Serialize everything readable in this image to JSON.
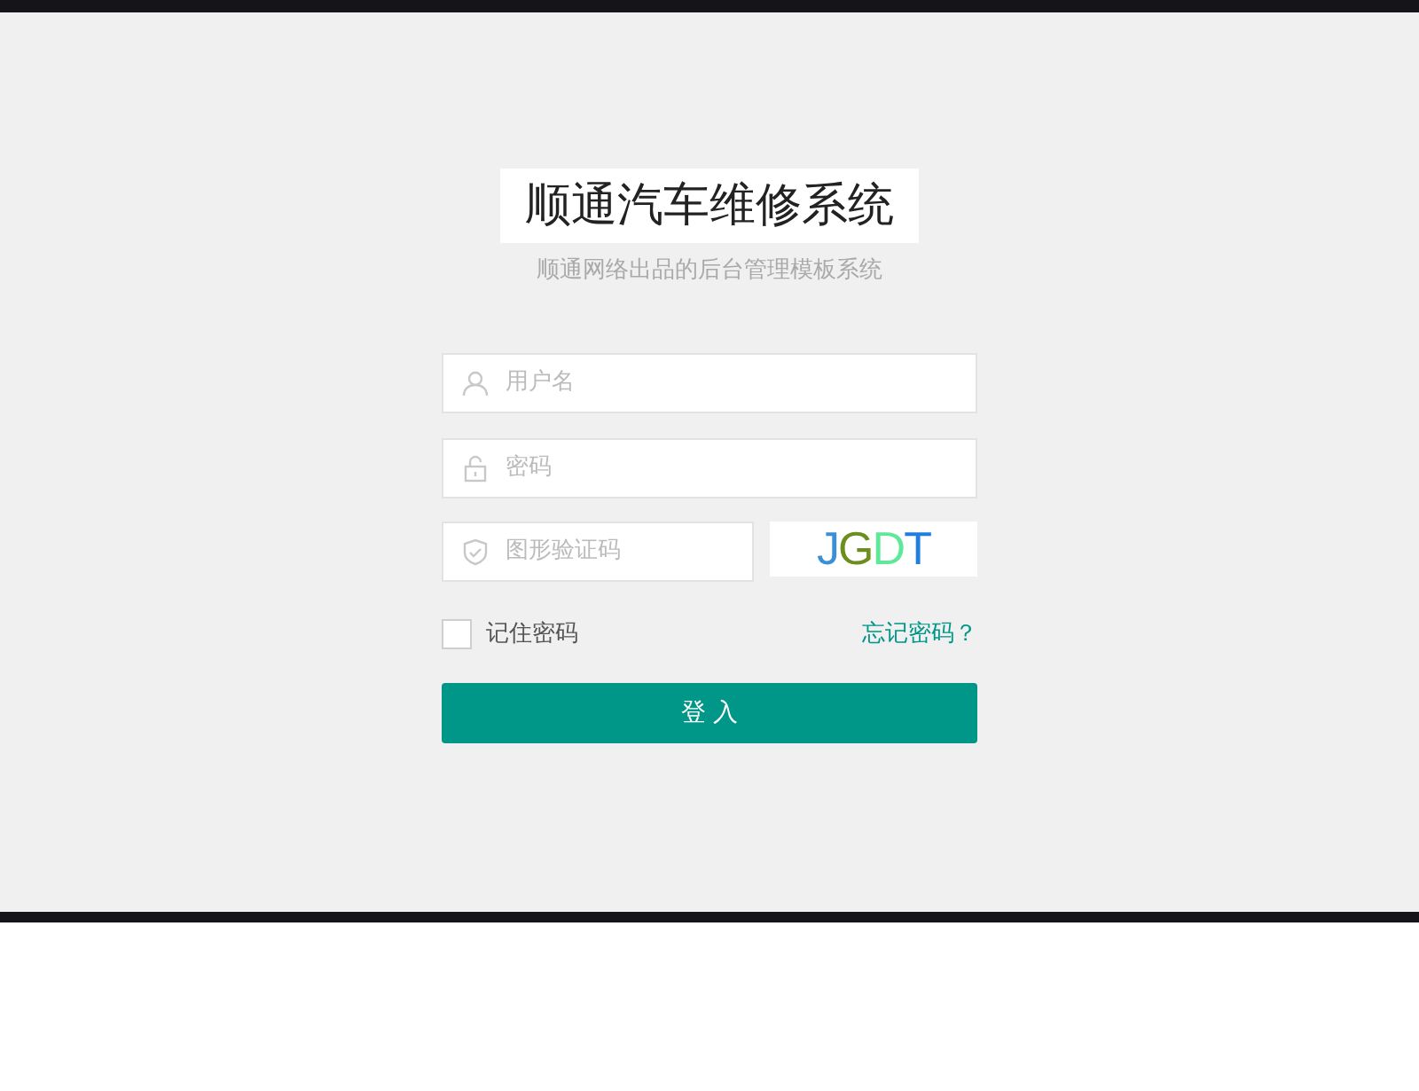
{
  "title": "顺通汽车维修系统",
  "subtitle": "顺通网络出品的后台管理模板系统",
  "fields": [
    {
      "kind": "user",
      "placeholder": "用户名"
    },
    {
      "kind": "lock",
      "placeholder": "密码"
    },
    {
      "kind": "shield",
      "placeholder": "图形验证码"
    }
  ],
  "captcha": [
    {
      "text": "J",
      "color": "#3a8fd6"
    },
    {
      "text": "G",
      "color": "#6b8e1e"
    },
    {
      "text": "D",
      "color": "#5ee89a"
    },
    {
      "text": "T",
      "color": "#1e7fe0"
    }
  ],
  "remember": {
    "label": "记住密码",
    "checked": false
  },
  "forgot_link": "忘记密码？",
  "login_button": "登 入"
}
